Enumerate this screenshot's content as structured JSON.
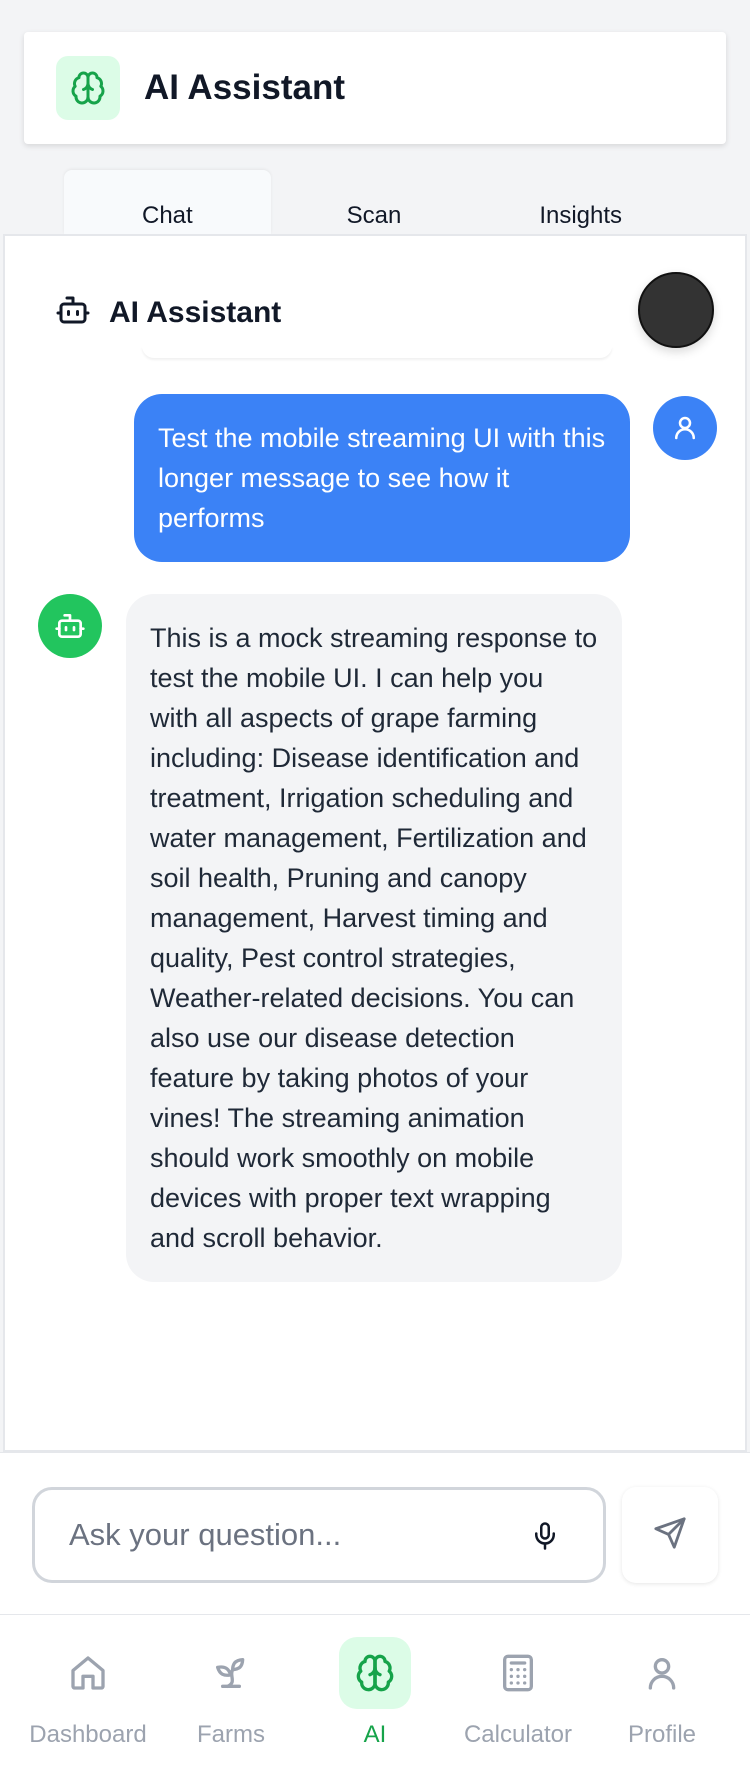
{
  "header": {
    "title": "AI Assistant",
    "icon": "brain-icon",
    "accent": "#22c55e"
  },
  "tabs": [
    {
      "label": "Chat",
      "active": true
    },
    {
      "label": "Scan",
      "active": false
    },
    {
      "label": "Insights",
      "active": false
    }
  ],
  "chat": {
    "title": "AI Assistant",
    "messages": [
      {
        "role": "user",
        "text": "Test the mobile streaming UI with this longer message to see how it performs"
      },
      {
        "role": "assistant",
        "text": "This is a mock streaming response to test the mobile UI. I can help you with all aspects of grape farming including: Disease identification and treatment, Irrigation scheduling and water management, Fertilization and soil health, Pruning and canopy management, Harvest timing and quality, Pest control strategies, Weather-related decisions. You can also use our disease detection feature by taking photos of your vines! The streaming animation should work smoothly on mobile devices with proper text wrapping and scroll behavior."
      }
    ]
  },
  "input": {
    "placeholder": "Ask your question...",
    "value": ""
  },
  "nav": [
    {
      "label": "Dashboard",
      "icon": "home-icon",
      "active": false
    },
    {
      "label": "Farms",
      "icon": "sprout-icon",
      "active": false
    },
    {
      "label": "AI",
      "icon": "brain-icon",
      "active": true
    },
    {
      "label": "Calculator",
      "icon": "calculator-icon",
      "active": false
    },
    {
      "label": "Profile",
      "icon": "user-icon",
      "active": false
    }
  ],
  "colors": {
    "user_bubble": "#3b82f6",
    "bot_avatar": "#22c55e",
    "active_nav": "#16a34a"
  }
}
